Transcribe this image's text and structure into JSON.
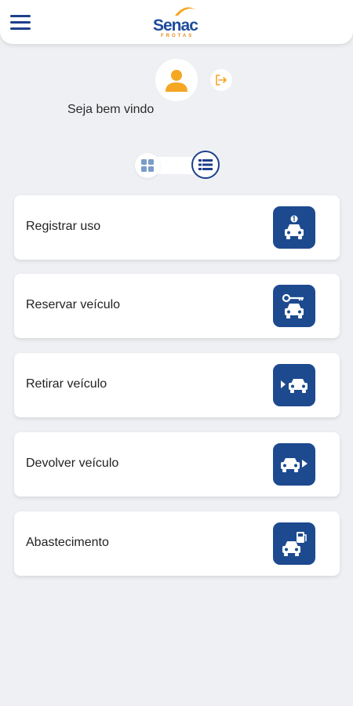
{
  "header": {
    "logo_text": "Senac",
    "logo_subtext": "FROTAS",
    "menu_icon": "hamburger-menu-icon"
  },
  "profile": {
    "welcome": "Seja bem vindo",
    "avatar_icon": "user-icon",
    "logout_icon": "logout-icon"
  },
  "view_toggle": {
    "options": [
      "grid-view-icon",
      "list-view-icon"
    ],
    "selected": "list-view-icon"
  },
  "menu": {
    "items": [
      {
        "label": "Registrar uso",
        "icon": "car-register-icon"
      },
      {
        "label": "Reservar veículo",
        "icon": "car-key-icon"
      },
      {
        "label": "Retirar veículo",
        "icon": "car-pickup-icon"
      },
      {
        "label": "Devolver veículo",
        "icon": "car-return-icon"
      },
      {
        "label": "Abastecimento",
        "icon": "car-fuel-icon"
      }
    ]
  },
  "colors": {
    "primary": "#1d4a8f",
    "accent": "#f5a623",
    "background": "#eef0f3"
  }
}
